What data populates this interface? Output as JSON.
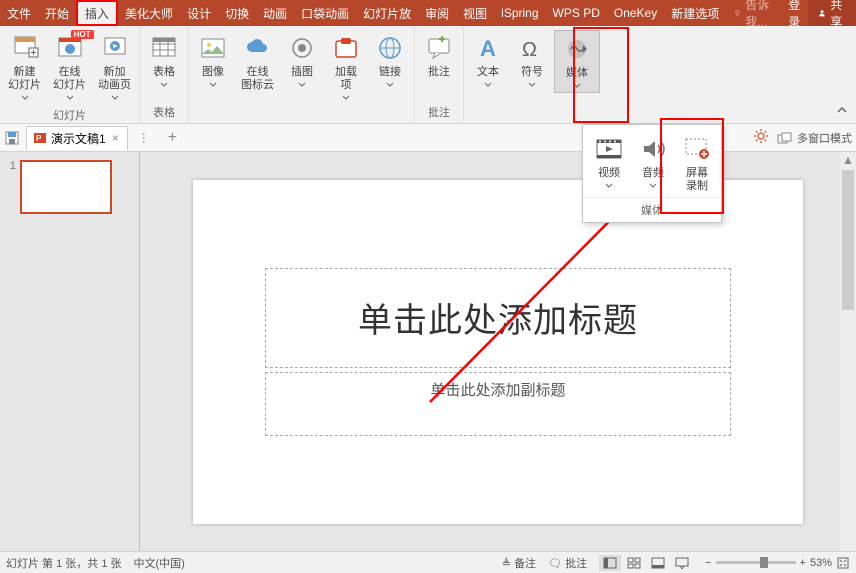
{
  "menu": {
    "items": [
      "文件",
      "开始",
      "插入",
      "美化大师",
      "设计",
      "切换",
      "动画",
      "口袋动画",
      "幻灯片放",
      "审阅",
      "视图",
      "iSpring",
      "WPS PD",
      "OneKey",
      "新建选项"
    ],
    "active_index": 2,
    "tell_me": "告诉我...",
    "login": "登录",
    "share": "共享"
  },
  "ribbon": {
    "groups": [
      {
        "label": "幻灯片",
        "buttons": [
          {
            "label": "新建\n幻灯片",
            "icon": "new-slide-icon",
            "dropdown": true,
            "hot": false
          },
          {
            "label": "在线\n幻灯片",
            "icon": "online-slide-icon",
            "dropdown": true,
            "hot": true
          },
          {
            "label": "新加\n动画页",
            "icon": "anim-page-icon",
            "dropdown": true,
            "hot": false
          }
        ]
      },
      {
        "label": "表格",
        "buttons": [
          {
            "label": "表格",
            "icon": "table-icon",
            "dropdown": true
          }
        ]
      },
      {
        "label": "",
        "buttons": [
          {
            "label": "图像",
            "icon": "image-icon",
            "dropdown": true
          },
          {
            "label": "在线\n图标云",
            "icon": "cloud-icons-icon",
            "dropdown": false
          },
          {
            "label": "插图",
            "icon": "illustration-icon",
            "dropdown": true
          },
          {
            "label": "加载\n项",
            "icon": "addin-icon",
            "dropdown": true
          },
          {
            "label": "链接",
            "icon": "link-icon",
            "dropdown": true
          }
        ]
      },
      {
        "label": "批注",
        "buttons": [
          {
            "label": "批注",
            "icon": "comment-icon",
            "dropdown": false
          }
        ]
      },
      {
        "label": "",
        "buttons": [
          {
            "label": "文本",
            "icon": "text-icon",
            "dropdown": true
          },
          {
            "label": "符号",
            "icon": "symbol-icon",
            "dropdown": true
          },
          {
            "label": "媒体",
            "icon": "media-icon",
            "dropdown": true,
            "highlighted": true
          }
        ]
      }
    ]
  },
  "tabs": {
    "doc_name": "演示文稿1",
    "close": "×",
    "handle": "⋮",
    "plus": "+"
  },
  "tabstrip_right": {
    "multi_window": "多窗口模式"
  },
  "thumbs": {
    "items": [
      {
        "num": "1"
      }
    ]
  },
  "slide": {
    "title_placeholder": "单击此处添加标题",
    "subtitle_placeholder": "单击此处添加副标题"
  },
  "media_popup": {
    "footer": "媒体",
    "buttons": [
      {
        "label": "视频",
        "icon": "video-icon",
        "dropdown": true
      },
      {
        "label": "音频",
        "icon": "audio-icon",
        "dropdown": true
      },
      {
        "label": "屏幕\n录制",
        "icon": "screen-record-icon",
        "dropdown": false,
        "highlighted": true
      }
    ]
  },
  "status": {
    "slide_info": "幻灯片 第 1 张，共 1 张",
    "lang": "中文(中国)",
    "notes": "备注",
    "comments": "批注",
    "zoom": "53%",
    "zoom_minus": "−",
    "zoom_plus": "+"
  },
  "colors": {
    "brand": "#b7472a",
    "annotation": "#ff0000"
  }
}
